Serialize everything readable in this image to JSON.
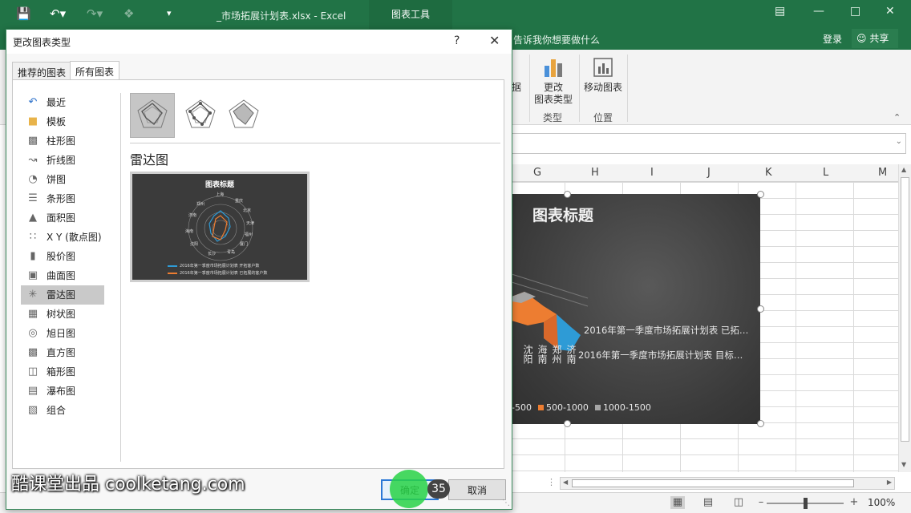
{
  "titlebar": {
    "file": "_市场拓展计划表.xlsx - Excel",
    "context_tab": "图表工具"
  },
  "ribbon": {
    "tell_me": "告诉我你想要做什么",
    "login": "登录",
    "share": "共享",
    "data_btn_tail": "据",
    "change_type": [
      "更改",
      "图表类型"
    ],
    "move_chart": "移动图表",
    "group_type": "类型",
    "group_location": "位置"
  },
  "columns": [
    "G",
    "H",
    "I",
    "J",
    "K",
    "L",
    "M"
  ],
  "chart": {
    "title": "图表标题",
    "series": [
      "2016年第一季度市场拓展计划表 已拓…",
      "2016年第一季度市场拓展计划表 目标…"
    ],
    "axis_labels": [
      "沈阳",
      "海南",
      "郑州",
      "济南"
    ],
    "legend": [
      "-500",
      "500-1000",
      "1000-1500"
    ],
    "colors": {
      "orange": "#ed7d31",
      "blue": "#2e9bd6",
      "gray": "#a5a5a5"
    }
  },
  "statusbar": {
    "zoom": "100%"
  },
  "dialog": {
    "title": "更改图表类型",
    "help": "?",
    "close": "✕",
    "tabs": [
      "推荐的图表",
      "所有图表"
    ],
    "categories": [
      {
        "label": "最近",
        "icon": "recent-icon"
      },
      {
        "label": "模板",
        "icon": "folder-icon"
      },
      {
        "label": "柱形图",
        "icon": "column-chart-icon"
      },
      {
        "label": "折线图",
        "icon": "line-chart-icon"
      },
      {
        "label": "饼图",
        "icon": "pie-chart-icon"
      },
      {
        "label": "条形图",
        "icon": "bar-chart-icon"
      },
      {
        "label": "面积图",
        "icon": "area-chart-icon"
      },
      {
        "label": "X Y (散点图)",
        "icon": "scatter-chart-icon"
      },
      {
        "label": "股价图",
        "icon": "stock-chart-icon"
      },
      {
        "label": "曲面图",
        "icon": "surface-chart-icon"
      },
      {
        "label": "雷达图",
        "icon": "radar-chart-icon"
      },
      {
        "label": "树状图",
        "icon": "treemap-chart-icon"
      },
      {
        "label": "旭日图",
        "icon": "sunburst-chart-icon"
      },
      {
        "label": "直方图",
        "icon": "histogram-chart-icon"
      },
      {
        "label": "箱形图",
        "icon": "box-chart-icon"
      },
      {
        "label": "瀑布图",
        "icon": "waterfall-chart-icon"
      },
      {
        "label": "组合",
        "icon": "combo-chart-icon"
      }
    ],
    "selected_type": "雷达图",
    "preview": {
      "title": "图表标题",
      "legend": [
        "2016年第一季度市场拓展计划表 开拓客户数",
        "2016年第一季度市场拓展计划表 已拓展的客户数"
      ],
      "axes": [
        "上海",
        "重庆",
        "北京",
        "天津",
        "福州",
        "厦门",
        "青岛",
        "长沙",
        "杭州",
        "沈阳",
        "海南",
        "济南",
        "郑州"
      ]
    },
    "ok": "确定",
    "cancel": "取消"
  },
  "overlay": {
    "watermark": "酷课堂出品 coolketang.com",
    "step": "35"
  }
}
